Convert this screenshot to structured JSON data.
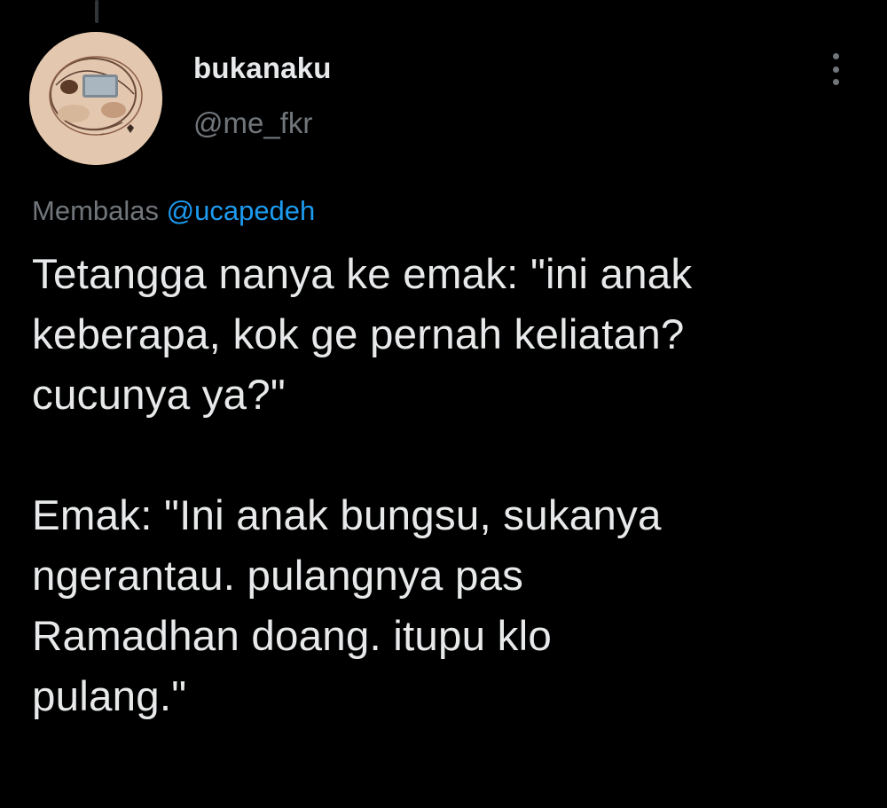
{
  "tweet": {
    "author_name": "bukanaku",
    "author_handle": "@me_fkr",
    "reply_prefix": "Membalas",
    "reply_mention": "@ucapedeh",
    "text": "Tetangga nanya ke emak: \"ini anak\nkeberapa, kok ge pernah keliatan?\ncucunya ya?\"\n\nEmak: \"Ini anak bungsu, sukanya\nngerantau. pulangnya pas\nRamadhan doang. itupu  klo\npulang.\""
  },
  "icons": {
    "more": "more-vertical-icon",
    "avatar": "profile-photo"
  },
  "colors": {
    "background": "#000000",
    "text_primary": "#e7e9ea",
    "text_secondary": "#71767b",
    "link": "#1d9bf0",
    "avatar_background": "#e3c7ae"
  }
}
